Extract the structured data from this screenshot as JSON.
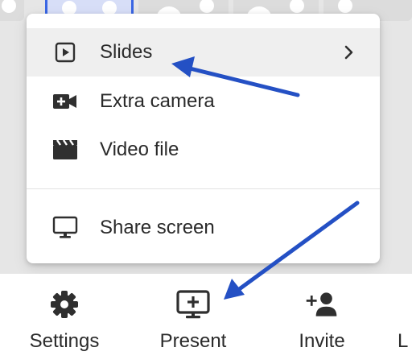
{
  "menu": {
    "items": [
      {
        "label": "Slides",
        "icon": "slides-play-icon",
        "has_submenu": true,
        "highlighted": true
      },
      {
        "label": "Extra camera",
        "icon": "camera-plus-icon",
        "has_submenu": false,
        "highlighted": false
      },
      {
        "label": "Video file",
        "icon": "clapperboard-icon",
        "has_submenu": false,
        "highlighted": false
      },
      {
        "label": "Share screen",
        "icon": "monitor-icon",
        "has_submenu": false,
        "highlighted": false
      }
    ]
  },
  "toolbar": {
    "items": [
      {
        "label": "Settings",
        "icon": "gear-icon"
      },
      {
        "label": "Present",
        "icon": "present-screen-icon"
      },
      {
        "label": "Invite",
        "icon": "add-person-icon"
      }
    ],
    "cut_off_label": "L"
  },
  "colors": {
    "annotation_arrow": "#2450c4",
    "selected_thumbnail_border": "#3a66e3",
    "menu_highlight": "#efefef",
    "icon": "#2f2f2f"
  }
}
